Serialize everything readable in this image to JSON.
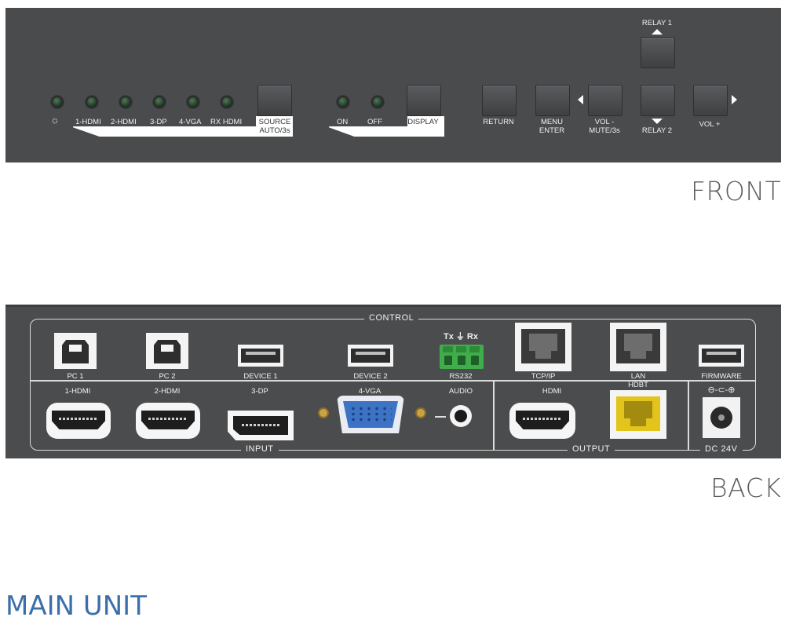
{
  "front": {
    "caption": "FRONT",
    "led_labels": [
      "1-HDMI",
      "2-HDMI",
      "3-DP",
      "4-VGA",
      "RX HDMI"
    ],
    "source_button": {
      "line1": "SOURCE",
      "line2": "AUTO/3s"
    },
    "display_led_labels": [
      "ON",
      "OFF"
    ],
    "display_button": "DISPLAY",
    "return_button": "RETURN",
    "menu_button": {
      "line1": "MENU",
      "line2": "ENTER"
    },
    "vol_minus_button": {
      "line1": "VOL -",
      "line2": "MUTE/3s"
    },
    "relay1_button": "RELAY 1",
    "relay2_button": "RELAY 2",
    "vol_plus_button": "VOL +"
  },
  "back": {
    "caption": "BACK",
    "control_label": "CONTROL",
    "input_label": "INPUT",
    "output_label": "OUTPUT",
    "dc_label": "DC 24V",
    "polarity_label": "⊖-⊂-⊕",
    "control_ports": [
      "PC 1",
      "PC 2",
      "DEVICE 1",
      "DEVICE 2",
      "RS232",
      "TCP/IP",
      "LAN",
      "FIRMWARE"
    ],
    "rs232_pins": "Tx ⏚ Rx",
    "input_ports": [
      "1-HDMI",
      "2-HDMI",
      "3-DP",
      "4-VGA",
      "AUDIO"
    ],
    "output_ports": [
      "HDMI",
      "HDBT"
    ]
  },
  "title": "MAIN UNIT",
  "colors": {
    "panel": "#4a4b4d",
    "title": "#3b6fa8",
    "led": "#2f5a38",
    "rs232": "#3fae4a",
    "hdbt": "#e2c41c"
  }
}
